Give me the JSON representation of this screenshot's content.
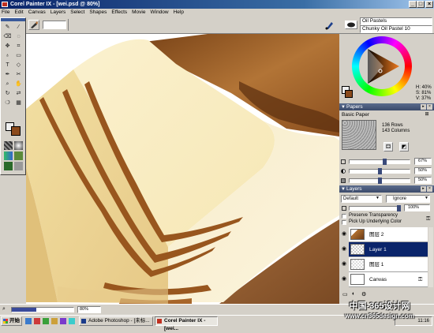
{
  "window": {
    "title": "Corel Painter IX - [wei.psd @ 80%]",
    "minimize_glyph": "_",
    "maximize_glyph": "□",
    "close_glyph": "×"
  },
  "menu": {
    "items": [
      "File",
      "Edit",
      "Canvas",
      "Layers",
      "Select",
      "Shapes",
      "Effects",
      "Movie",
      "Window",
      "Help"
    ]
  },
  "property_bar": {
    "brush_category": "Oil Pastels",
    "brush_variant": "Chunky Oil Pastel 10"
  },
  "colors": {
    "main": "#8b4a1c",
    "additional": "#f0f0f0",
    "accent_titlebar": "#0a246a",
    "cake_cream": "#f3e6b8",
    "chocolate": "#9a5a22",
    "dark_chocolate": "#6b3a14"
  },
  "color_palette": {
    "h_readout": "H: 40%",
    "s_readout": "S: 81%",
    "v_readout": "V: 37%"
  },
  "papers": {
    "title": "Papers",
    "paper_name": "Basic Paper",
    "rows": "136 Rows",
    "columns": "143 Columns",
    "slider1_value": "67%",
    "slider2_value": "50%",
    "slider3_value": "50%"
  },
  "layers": {
    "title": "Layers",
    "composite_method": "Default",
    "composite_depth": "Ignore",
    "opacity_value": "100%",
    "preserve_transparency_label": "Preserve Transparency",
    "pick_up_color_label": "Pick Up Underlying Color",
    "rows": [
      {
        "name": "图层 2"
      },
      {
        "name": "Layer 1"
      },
      {
        "name": "图层 1"
      },
      {
        "name": "Canvas"
      }
    ]
  },
  "status": {
    "zoom_value": "80%"
  },
  "taskbar": {
    "start_label": "开始",
    "tasks": [
      "Adobe Photoshop - [未标...",
      "Corel Painter IX - [wei..."
    ],
    "clock": "11:16"
  },
  "watermark": {
    "line1": "中国-365设计网",
    "line2": "www.cn365design.com"
  }
}
